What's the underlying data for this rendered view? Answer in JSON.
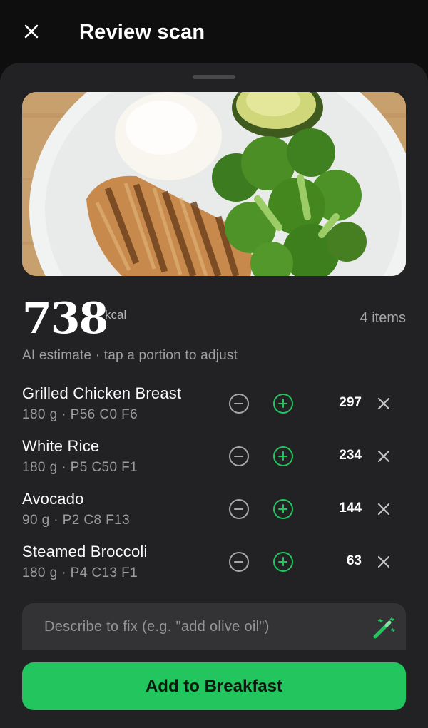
{
  "header": {
    "title": "Review scan",
    "close_icon": "close-icon"
  },
  "photo": {
    "subject": "meal-photo",
    "contents": [
      "rice",
      "grilled-chicken",
      "avocado",
      "broccoli"
    ]
  },
  "summary": {
    "total_kcal": "738",
    "unit": "kcal",
    "items_count": "4 items",
    "subtitle": "AI estimate · tap a portion to adjust"
  },
  "items": [
    {
      "name": "Grilled Chicken Breast",
      "meta": "180 g · P56 C0 F6",
      "kcal": "297"
    },
    {
      "name": "White Rice",
      "meta": "180 g · P5 C50 F1",
      "kcal": "234"
    },
    {
      "name": "Avocado",
      "meta": "90 g · P2 C8 F13",
      "kcal": "144"
    },
    {
      "name": "Steamed Broccoli",
      "meta": "180 g · P4 C13 F1",
      "kcal": "63"
    }
  ],
  "fix": {
    "placeholder": "Describe to fix (e.g. \"add olive oil\")",
    "value": "",
    "icon": "magic-wand-icon"
  },
  "cta": {
    "label": "Add to Breakfast"
  },
  "colors": {
    "accent": "#22c55e",
    "background": "#0e0e0e",
    "sheet": "#222224",
    "input": "#333336"
  }
}
